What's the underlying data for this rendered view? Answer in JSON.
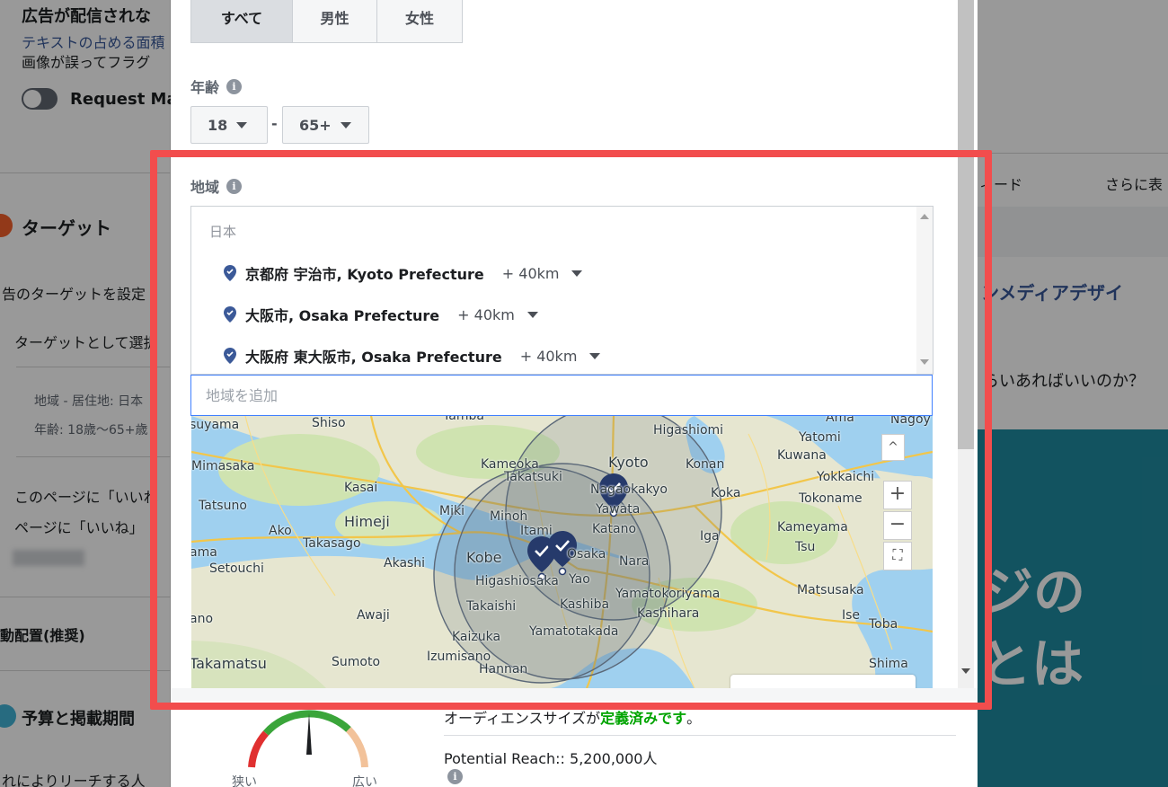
{
  "background": {
    "left_texts": {
      "heading": "広告が配信されな",
      "link_text": "テキストの占める面積",
      "note": "画像が誤ってフラグ",
      "toggle_label": "Request Ma",
      "target_title": "ターゲット",
      "target_desc": "告のターゲットを設定",
      "target_radio": "ターゲットとして選択",
      "region_summary": "地域 - 居住地: 日本",
      "age_summary": "年齢: 18歳〜65+歳",
      "like_option_1": "このページに「いいね",
      "like_option_2": "ページに「いいね」",
      "placement": "動配置(推奨)",
      "budget_title": "予算と掲載期間",
      "reach_note": "れによりリーチする人"
    },
    "right_texts": {
      "tab_feed": "ィード",
      "tab_more": "さらに表",
      "article_title": "ンメディアデザイ",
      "question": "らいあればいいのか？",
      "banner_line1": "ジの",
      "banner_line2": "とは"
    }
  },
  "modal": {
    "gender": {
      "options": [
        "すべて",
        "男性",
        "女性"
      ],
      "selected": "すべて"
    },
    "age": {
      "label": "年齢",
      "min": "18",
      "max": "65+",
      "separator": "-"
    },
    "location": {
      "label": "地域",
      "country": "日本",
      "items": [
        {
          "name": "京都府 宇治市, Kyoto Prefecture",
          "radius": "+ 40km"
        },
        {
          "name": "大阪市, Osaka Prefecture",
          "radius": "+ 40km"
        },
        {
          "name": "大阪府 東大阪市, Osaka Prefecture",
          "radius": "+ 40km"
        }
      ],
      "add_placeholder": "地域を追加"
    },
    "map": {
      "labels": [
        "suyama",
        "Shiso",
        "Tamba",
        "Higashiomi",
        "Ama",
        "Nagoy",
        "Yatomi",
        "Mimasaka",
        "Kameoka",
        "Kyoto",
        "Konan",
        "Kuwana",
        "Yokkaichi",
        "Kasai",
        "Takatsuki",
        "Nagaokakyo",
        "Koka",
        "Tokoname",
        "Tatsuno",
        "Minoh",
        "Miki",
        "Yawata",
        "Himeji",
        "Itami",
        "Katano",
        "Iga",
        "Kameyama",
        "Ako",
        "Takasago",
        "Tsu",
        "Kobe",
        "Osaka",
        "Akashi",
        "Nara",
        "ama",
        "Setouchi",
        "Higashiosaka",
        "Yao",
        "Yamatokoriyama",
        "Matsusaka",
        "Takaishi",
        "Kashiba",
        "Kashihara",
        "Ise",
        "ano",
        "Awaji",
        "Toba",
        "Kaizuka",
        "Yamatotakada",
        "Takamatsu",
        "Sumoto",
        "Izumisano",
        "Hannan",
        "Shima"
      ],
      "zoom_in": "+",
      "zoom_out": "−",
      "colors": {
        "pin": "#263a6b",
        "circle": "#5b6878",
        "water": "#9fd0ef",
        "land": "#e6e6d0"
      }
    },
    "audience": {
      "text_prefix": "オーディエンスサイズが",
      "text_status": "定義済みです",
      "text_suffix": "。",
      "reach": "Potential Reach:: 5,200,000人",
      "gauge_narrow": "狭い",
      "gauge_wide": "広い"
    }
  },
  "highlight_color": "#f24d4d"
}
